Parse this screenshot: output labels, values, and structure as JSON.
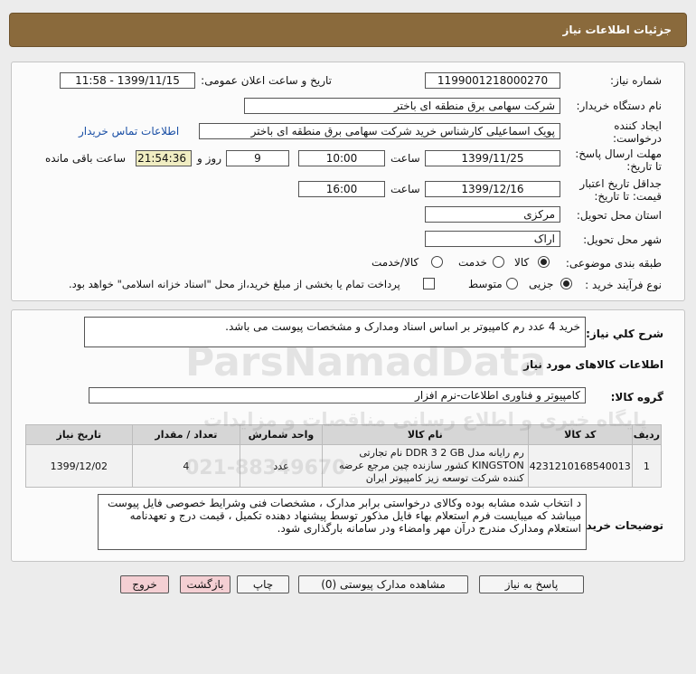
{
  "header": {
    "title": "جزئیات اطلاعات نیاز"
  },
  "details": {
    "need_number_label": "شماره نیاز:",
    "need_number": "1199001218000270",
    "announce_label": "تاریخ و ساعت اعلان عمومی:",
    "announce_value": "1399/11/15 - 11:58",
    "buyer_org_label": "نام دستگاه خریدار:",
    "buyer_org": "شرکت سهامی برق منطقه ای باختر",
    "requester_label": "ایجاد کننده درخواست:",
    "requester": "پویک اسماعیلی کارشناس خرید شرکت سهامی برق منطقه ای باختر",
    "contact_link": "اطلاعات تماس خریدار",
    "deadline_label": "مهلت ارسال پاسخ: تا تاریخ:",
    "deadline_date": "1399/11/25",
    "time_label": "ساعت",
    "deadline_time": "10:00",
    "days_value": "9",
    "days_label": "روز و",
    "remaining_time": "21:54:36",
    "remaining_label": "ساعت باقی مانده",
    "validity_label": "جداقل تاریخ اعتبار قیمت: تا تاریخ:",
    "validity_date": "1399/12/16",
    "validity_time_label": "ساعت",
    "validity_time": "16:00",
    "province_label": "استان محل تحویل:",
    "province": "مرکزی",
    "city_label": "شهر محل تحویل:",
    "city": "اراک",
    "category_label": "طبقه بندی موضوعی:",
    "category_options": [
      "کالا",
      "خدمت",
      "کالا/خدمت"
    ],
    "process_label": "نوع فرآیند خرید :",
    "process_options": [
      "جزیی",
      "متوسط"
    ],
    "payment_note": "پرداخت تمام یا بخشی از مبلغ خرید،از محل \"اسناد خزانه اسلامی\" خواهد بود."
  },
  "summary": {
    "label": "شرح کلي نياز:",
    "text": "خرید 4 عدد رم کامپیوتر بر اساس اسناد ومدارک و مشخصات پیوست می باشد."
  },
  "goods": {
    "section_title": "اطلاعات کالاهای مورد نیاز",
    "group_label": "گروه کالا:",
    "group_value": "کامپیوتر و فناوری اطلاعات-نرم افزار",
    "table": {
      "headers": [
        "ردیف",
        "کد کالا",
        "نام کالا",
        "واحد شمارش",
        "تعداد / مقدار",
        "تاریخ نیاز"
      ],
      "rows": [
        {
          "index": "1",
          "code": "4231210168540013",
          "name": "رم رایانه مدل DDR 3 2 GB نام تجارتی KINGSTON کشور سازنده چین مرجع عرضه کننده شرکت توسعه زیز کامپیوتر ایران",
          "unit": "عدد",
          "qty": "4",
          "date": "1399/12/02"
        }
      ]
    }
  },
  "notes": {
    "label": "توضیحات خریدار:",
    "text": "د انتخاب شده مشابه بوده وکالای درخواستی برابر مدارک ، مشخصات فنی وشرایط خصوصی فایل پیوست میباشد که میبایست فرم استعلام بهاء فایل مذکور توسط پیشنهاد دهنده تکمیل ، قیمت درج و تعهدنامه استعلام ومدارک مندرج درآن مهر وامضاء ودر سامانه بارگذاری شود."
  },
  "buttons": {
    "reply": "پاسخ به نیاز",
    "attachments": "مشاهده مدارک پیوستی (0)",
    "print": "چاپ",
    "back": "بازگشت",
    "exit": "خروج"
  },
  "watermark": {
    "brand": "ParsNamadData",
    "tagline": "پایگاه خبری و اطلاع رسانی مناقصات و مزایدات",
    "phone": "021-88349670"
  }
}
